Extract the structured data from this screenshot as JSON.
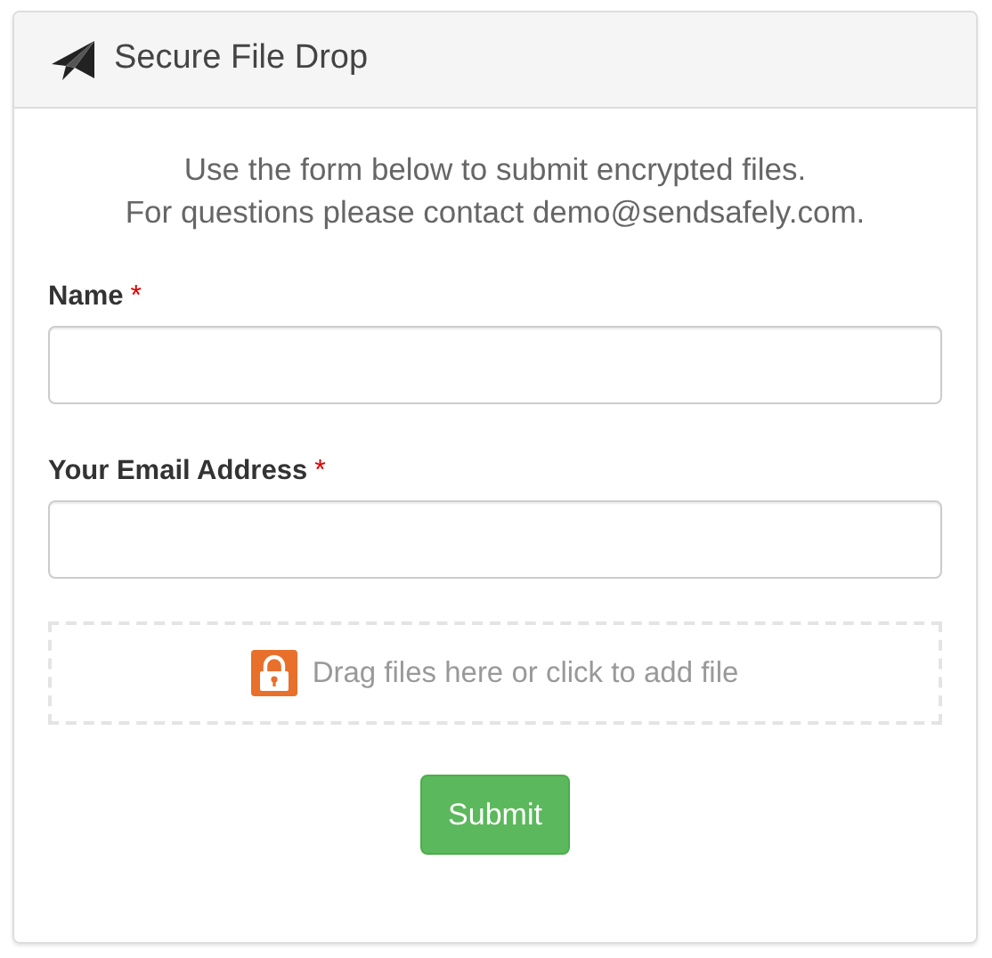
{
  "header": {
    "title": "Secure File Drop"
  },
  "intro": [
    "Use the form below to submit encrypted files.",
    "For questions please contact demo@sendsafely.com."
  ],
  "fields": [
    {
      "label": "Name",
      "required_mark": "*"
    },
    {
      "label": "Your Email Address",
      "required_mark": "*"
    }
  ],
  "dropzone": {
    "text": "Drag files here or click to add file"
  },
  "submit": "Submit"
}
